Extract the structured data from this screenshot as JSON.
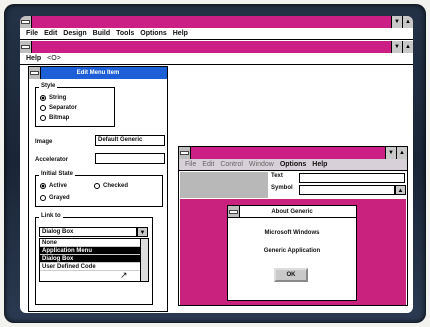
{
  "main_window": {
    "menu": [
      "File",
      "Edit",
      "Design",
      "Build",
      "Tools",
      "Options",
      "Help"
    ],
    "sub_menu": [
      "Help",
      "<O>"
    ]
  },
  "edit_menu_item": {
    "title": "Edit Menu Item",
    "style_group": "Style",
    "style_options": [
      "String",
      "Separator",
      "Bitmap"
    ],
    "image_label": "Image",
    "image_value": "Default Generic",
    "accelerator_label": "Accelerator",
    "initial_state_group": "Initial State",
    "initial_state_options": [
      "Active",
      "Grayed",
      "Checked"
    ],
    "link_to_group": "Link to",
    "link_to_value": "Dialog Box",
    "link_items": [
      "None",
      "Application Menu",
      "Dialog Box",
      "User Defined Code"
    ]
  },
  "generic_window": {
    "menu": [
      "File",
      "Edit",
      "Control",
      "Window",
      "Options",
      "Help"
    ],
    "field_labels": [
      "Text",
      "Symbol"
    ]
  },
  "about_dialog": {
    "title": "About Generic",
    "line1": "Microsoft Windows",
    "line2": "Generic Application",
    "ok": "OK"
  },
  "colors": {
    "accent": "#cc1f86",
    "bezel": "#1a2536"
  }
}
